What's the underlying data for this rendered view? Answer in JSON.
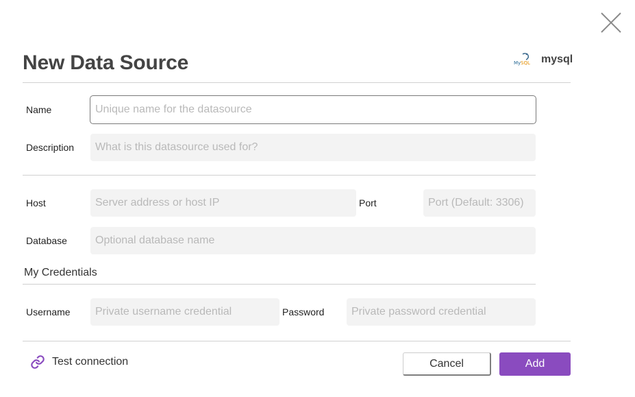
{
  "dialog": {
    "title": "New Data Source",
    "datasource_type": "mysql",
    "datasource_logo_icon": "mysql-dolphin-icon",
    "close_icon": "close-icon"
  },
  "form": {
    "name": {
      "label": "Name",
      "placeholder": "Unique name for the datasource",
      "value": ""
    },
    "description": {
      "label": "Description",
      "placeholder": "What is this datasource used for?",
      "value": ""
    },
    "host": {
      "label": "Host",
      "placeholder": "Server address or host IP",
      "value": ""
    },
    "port": {
      "label": "Port",
      "placeholder": "Port (Default: 3306)",
      "value": ""
    },
    "database": {
      "label": "Database",
      "placeholder": "Optional database name",
      "value": ""
    },
    "credentials_section": "My Credentials",
    "username": {
      "label": "Username",
      "placeholder": "Private username credential",
      "value": ""
    },
    "password": {
      "label": "Password",
      "placeholder": "Private password credential",
      "value": ""
    }
  },
  "footer": {
    "test_connection_label": "Test connection",
    "test_connection_icon": "link-icon",
    "cancel_label": "Cancel",
    "add_label": "Add"
  },
  "colors": {
    "accent": "#8a4bbf",
    "field_background": "#f3f3f3",
    "placeholder": "#b9b9b9",
    "divider": "#d0d0d0"
  }
}
